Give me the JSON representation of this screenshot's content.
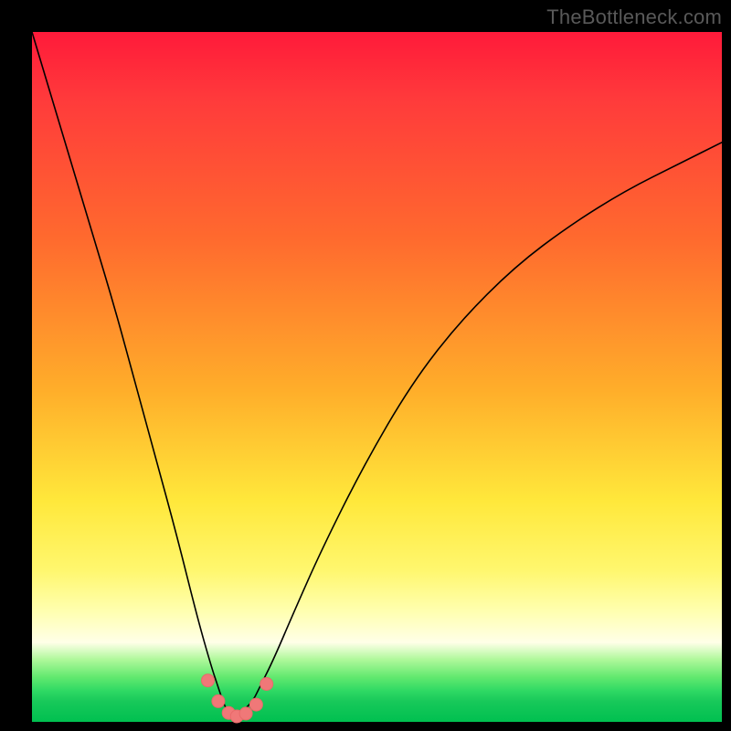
{
  "watermark": "TheBottleneck.com",
  "colors": {
    "frame": "#000000",
    "curve": "#000000",
    "marker_fill": "#f07878",
    "marker_stroke": "#e86a6a"
  },
  "chart_data": {
    "type": "line",
    "title": "",
    "xlabel": "",
    "ylabel": "",
    "xlim": [
      0,
      100
    ],
    "ylim": [
      0,
      100
    ],
    "grid": false,
    "legend": false,
    "note": "V-shaped bottleneck curve; y≈0 at the dip near x≈29, rising steeply on both sides. Values estimated from pixels.",
    "series": [
      {
        "name": "bottleneck-curve",
        "x": [
          0,
          3,
          6,
          9,
          12,
          15,
          18,
          21,
          24,
          26,
          27,
          28,
          29,
          30,
          31,
          32,
          33,
          35,
          38,
          42,
          48,
          55,
          62,
          70,
          78,
          86,
          94,
          100
        ],
        "values": [
          100,
          90,
          80,
          70,
          60,
          49,
          38,
          27,
          15,
          8,
          5,
          2,
          1,
          1,
          2,
          3,
          5,
          9,
          16,
          25,
          37,
          49,
          58,
          66,
          72,
          77,
          81,
          84
        ]
      }
    ],
    "markers": {
      "name": "dip-markers",
      "x": [
        25.5,
        27.0,
        28.5,
        29.7,
        31.0,
        32.5,
        34.0
      ],
      "values": [
        6.0,
        3.0,
        1.3,
        0.8,
        1.2,
        2.5,
        5.5
      ]
    }
  }
}
